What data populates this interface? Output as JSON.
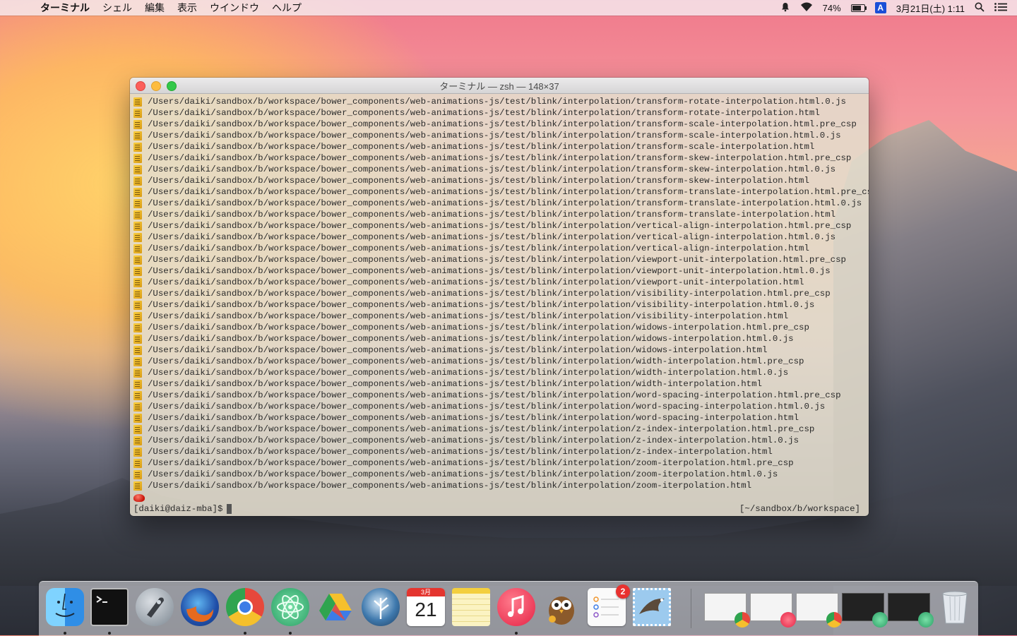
{
  "menubar": {
    "app_name": "ターミナル",
    "items": [
      "シェル",
      "編集",
      "表示",
      "ウインドウ",
      "ヘルプ"
    ],
    "battery": "74%",
    "input_method": "A",
    "datetime": "3月21日(土) 1:11"
  },
  "window": {
    "title": "ターミナル — zsh — 148×37"
  },
  "terminal": {
    "lines": [
      "/Users/daiki/sandbox/b/workspace/bower_components/web-animations-js/test/blink/interpolation/transform-rotate-interpolation.html.0.js",
      "/Users/daiki/sandbox/b/workspace/bower_components/web-animations-js/test/blink/interpolation/transform-rotate-interpolation.html",
      "/Users/daiki/sandbox/b/workspace/bower_components/web-animations-js/test/blink/interpolation/transform-scale-interpolation.html.pre_csp",
      "/Users/daiki/sandbox/b/workspace/bower_components/web-animations-js/test/blink/interpolation/transform-scale-interpolation.html.0.js",
      "/Users/daiki/sandbox/b/workspace/bower_components/web-animations-js/test/blink/interpolation/transform-scale-interpolation.html",
      "/Users/daiki/sandbox/b/workspace/bower_components/web-animations-js/test/blink/interpolation/transform-skew-interpolation.html.pre_csp",
      "/Users/daiki/sandbox/b/workspace/bower_components/web-animations-js/test/blink/interpolation/transform-skew-interpolation.html.0.js",
      "/Users/daiki/sandbox/b/workspace/bower_components/web-animations-js/test/blink/interpolation/transform-skew-interpolation.html",
      "/Users/daiki/sandbox/b/workspace/bower_components/web-animations-js/test/blink/interpolation/transform-translate-interpolation.html.pre_csp",
      "/Users/daiki/sandbox/b/workspace/bower_components/web-animations-js/test/blink/interpolation/transform-translate-interpolation.html.0.js",
      "/Users/daiki/sandbox/b/workspace/bower_components/web-animations-js/test/blink/interpolation/transform-translate-interpolation.html",
      "/Users/daiki/sandbox/b/workspace/bower_components/web-animations-js/test/blink/interpolation/vertical-align-interpolation.html.pre_csp",
      "/Users/daiki/sandbox/b/workspace/bower_components/web-animations-js/test/blink/interpolation/vertical-align-interpolation.html.0.js",
      "/Users/daiki/sandbox/b/workspace/bower_components/web-animations-js/test/blink/interpolation/vertical-align-interpolation.html",
      "/Users/daiki/sandbox/b/workspace/bower_components/web-animations-js/test/blink/interpolation/viewport-unit-interpolation.html.pre_csp",
      "/Users/daiki/sandbox/b/workspace/bower_components/web-animations-js/test/blink/interpolation/viewport-unit-interpolation.html.0.js",
      "/Users/daiki/sandbox/b/workspace/bower_components/web-animations-js/test/blink/interpolation/viewport-unit-interpolation.html",
      "/Users/daiki/sandbox/b/workspace/bower_components/web-animations-js/test/blink/interpolation/visibility-interpolation.html.pre_csp",
      "/Users/daiki/sandbox/b/workspace/bower_components/web-animations-js/test/blink/interpolation/visibility-interpolation.html.0.js",
      "/Users/daiki/sandbox/b/workspace/bower_components/web-animations-js/test/blink/interpolation/visibility-interpolation.html",
      "/Users/daiki/sandbox/b/workspace/bower_components/web-animations-js/test/blink/interpolation/widows-interpolation.html.pre_csp",
      "/Users/daiki/sandbox/b/workspace/bower_components/web-animations-js/test/blink/interpolation/widows-interpolation.html.0.js",
      "/Users/daiki/sandbox/b/workspace/bower_components/web-animations-js/test/blink/interpolation/widows-interpolation.html",
      "/Users/daiki/sandbox/b/workspace/bower_components/web-animations-js/test/blink/interpolation/width-interpolation.html.pre_csp",
      "/Users/daiki/sandbox/b/workspace/bower_components/web-animations-js/test/blink/interpolation/width-interpolation.html.0.js",
      "/Users/daiki/sandbox/b/workspace/bower_components/web-animations-js/test/blink/interpolation/width-interpolation.html",
      "/Users/daiki/sandbox/b/workspace/bower_components/web-animations-js/test/blink/interpolation/word-spacing-interpolation.html.pre_csp",
      "/Users/daiki/sandbox/b/workspace/bower_components/web-animations-js/test/blink/interpolation/word-spacing-interpolation.html.0.js",
      "/Users/daiki/sandbox/b/workspace/bower_components/web-animations-js/test/blink/interpolation/word-spacing-interpolation.html",
      "/Users/daiki/sandbox/b/workspace/bower_components/web-animations-js/test/blink/interpolation/z-index-interpolation.html.pre_csp",
      "/Users/daiki/sandbox/b/workspace/bower_components/web-animations-js/test/blink/interpolation/z-index-interpolation.html.0.js",
      "/Users/daiki/sandbox/b/workspace/bower_components/web-animations-js/test/blink/interpolation/z-index-interpolation.html",
      "/Users/daiki/sandbox/b/workspace/bower_components/web-animations-js/test/blink/interpolation/zoom-iterpolation.html.pre_csp",
      "/Users/daiki/sandbox/b/workspace/bower_components/web-animations-js/test/blink/interpolation/zoom-iterpolation.html.0.js",
      "/Users/daiki/sandbox/b/workspace/bower_components/web-animations-js/test/blink/interpolation/zoom-iterpolation.html"
    ],
    "prompt": "[daiki@daiz-mba]$",
    "rprompt": "[~/sandbox/b/workspace]"
  },
  "dock": {
    "calendar_month": "3月",
    "calendar_day": "21",
    "reminders_badge": "2",
    "apps": [
      {
        "name": "finder",
        "color": "#3aa0f0",
        "running": true
      },
      {
        "name": "terminal",
        "color": "#1b1b1b",
        "running": true
      },
      {
        "name": "launchpad",
        "color": "#8e9aa6",
        "running": false
      },
      {
        "name": "firefox",
        "color": "#2d5fb5",
        "running": false
      },
      {
        "name": "chrome",
        "color": "#e7483b",
        "running": true
      },
      {
        "name": "atom",
        "color": "#4cc38a",
        "running": true
      },
      {
        "name": "google-drive",
        "color": "#f2b51a",
        "running": false
      },
      {
        "name": "sourcetree",
        "color": "#2e5f8e",
        "running": false
      },
      {
        "name": "calendar",
        "color": "#ffffff",
        "running": false
      },
      {
        "name": "notes",
        "color": "#f7e27b",
        "running": false
      },
      {
        "name": "itunes",
        "color": "#f43b5a",
        "running": true
      },
      {
        "name": "night-owl",
        "color": "#9a6a3a",
        "running": false
      },
      {
        "name": "reminders",
        "color": "#fafafa",
        "running": false
      },
      {
        "name": "mail",
        "color": "#8fc3e8",
        "running": false
      }
    ]
  }
}
